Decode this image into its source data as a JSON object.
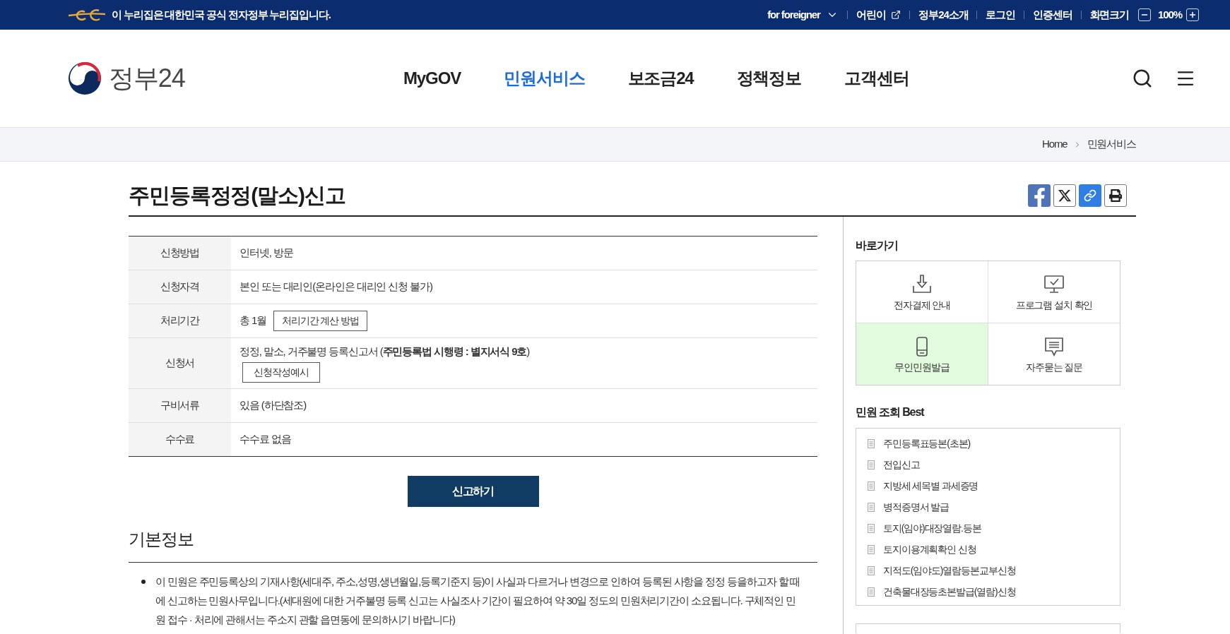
{
  "top_bar": {
    "notice": "이 누리집은 대한민국 공식 전자정부 누리집입니다.",
    "links": [
      {
        "label": "for foreigner",
        "kind": "dropdown"
      },
      {
        "label": "어린이",
        "kind": "external"
      },
      {
        "label": "정부24소개",
        "kind": "plain"
      },
      {
        "label": "로그인",
        "kind": "plain"
      },
      {
        "label": "인증센터",
        "kind": "plain"
      }
    ],
    "zoom": {
      "label": "화면크기",
      "value": "100%"
    }
  },
  "header": {
    "logo_text": "정부24",
    "nav": [
      {
        "label": "MyGOV",
        "selected": false
      },
      {
        "label": "민원서비스",
        "selected": true
      },
      {
        "label": "보조금24",
        "selected": false
      },
      {
        "label": "정책정보",
        "selected": false
      },
      {
        "label": "고객센터",
        "selected": false
      }
    ]
  },
  "breadcrumb": [
    "Home",
    "민원서비스"
  ],
  "page": {
    "title": "주민등록정정(말소)신고",
    "info_table": {
      "rows": [
        {
          "header": "신청방법",
          "value": "인터넷, 방문",
          "kind": "text"
        },
        {
          "header": "신청자격",
          "value": "본인 또는 대리인(온라인은 대리인 신청 불가)",
          "kind": "text"
        },
        {
          "header": "처리기간",
          "value": "총 1월",
          "kind": "inline",
          "button": "처리기간 계산 방법"
        },
        {
          "header": "신청서",
          "value": "정정, 말소, 거주불명 등록신고서 (**주민등록법 시행령 : 별지서식 9호**)",
          "kind": "stacked",
          "button": "신청작성예시"
        },
        {
          "header": "구비서류",
          "value": "있음 (하단참조)",
          "kind": "text"
        },
        {
          "header": "수수료",
          "value": "수수료 없음",
          "kind": "text"
        }
      ]
    },
    "submit_button": "신고하기",
    "basic_info": {
      "heading": "기본정보",
      "items": [
        "이 민원은 주민등록상의 기재사항(세대주, 주소,성명,생년월일,등록기준지 등)이 사실과 다르거나 변경으로 인하여 등록된 사항을 정정 등을하고자 할 때에 신고하는 민원사무입니다.(세대원에 대한 거주불명 등록 신고는 사실조사 기간이 필요하여 약 30일 정도의 민원처리기간이 소요됩니다. 구체적인 민원 접수 · 처리에 관해서는 주소지 관할 읍면동에 문의하시기 바랍니다)"
      ]
    }
  },
  "sidebar": {
    "quick_links": {
      "heading": "바로가기",
      "items": [
        {
          "label": "전자결제 안내",
          "kind": "download",
          "selected": false
        },
        {
          "label": "프로그램 설치 확인",
          "kind": "monitor",
          "selected": false
        },
        {
          "label": "무인민원발급",
          "kind": "kiosk",
          "selected": true
        },
        {
          "label": "자주묻는 질문",
          "kind": "chat",
          "selected": false
        }
      ]
    },
    "best": {
      "heading": "민원 조회 Best",
      "items": [
        "주민등록표등본(초본)",
        "전입신고",
        "지방세 세목별 과세증명",
        "병적증명서 발급",
        "토지(임야)대장열람.등본",
        "토지이용계획확인 신청",
        "지적도(임야도)열람등본교부신청",
        "건축물대장등초본발급(열람)신청"
      ]
    }
  }
}
